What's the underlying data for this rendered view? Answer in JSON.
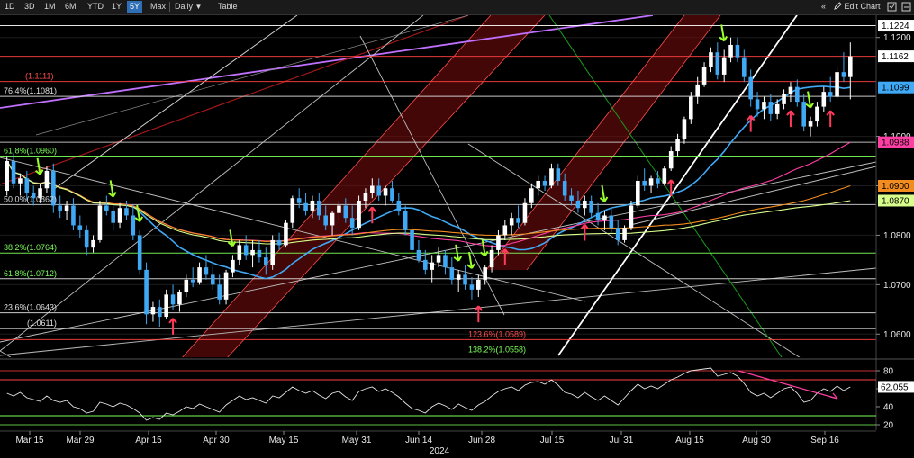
{
  "toolbar": {
    "ranges": [
      "1D",
      "3D",
      "1M",
      "6M",
      "YTD",
      "1Y",
      "5Y",
      "Max"
    ],
    "active": "5Y",
    "frequency": "Daily",
    "frequency_arrow": "▼",
    "table": "Table",
    "collapse_icon": "«",
    "edit_chart": "Edit Chart",
    "edit_icon": "pencil-icon",
    "expand_icon": "expand-icon"
  },
  "price_badges": [
    {
      "value": "1.1224",
      "bg": "#ffffff",
      "fg": "#000000"
    },
    {
      "value": "1.1162",
      "bg": "#ffffff",
      "fg": "#000000"
    },
    {
      "value": "1.1099",
      "bg": "#3fa9f5",
      "fg": "#000000"
    },
    {
      "value": "1.0988",
      "bg": "#ff3fa4",
      "fg": "#000000"
    },
    {
      "value": "1.0900",
      "bg": "#f28c1f",
      "fg": "#000000"
    },
    {
      "value": "1.0870",
      "bg": "#d8ff8c",
      "fg": "#000000"
    }
  ],
  "rsi_badge": {
    "value": "62.055",
    "bg": "#ffffff",
    "fg": "#000000"
  },
  "fib_labels": [
    {
      "text": "76.4%(1.1081)",
      "color": "#e0e0e0"
    },
    {
      "text": "61.8%(1.0960)",
      "color": "#7cff5a"
    },
    {
      "text": "50.0%(1.0862)",
      "color": "#d8d8d8"
    },
    {
      "text": "38.2%(1.0764)",
      "color": "#7cff5a"
    },
    {
      "text": "61.8%(1.0712)",
      "color": "#7cff5a"
    },
    {
      "text": "23.6%(1.0643)",
      "color": "#e0e0e0"
    },
    {
      "text": "(1.0611)",
      "color": "#e0e0e0"
    },
    {
      "text": "(1.1111)",
      "color": "#ff5050"
    },
    {
      "text": "123.6%(1.0589)",
      "color": "#ff5050"
    },
    {
      "text": "138.2%(1.0558)",
      "color": "#7cff5a"
    }
  ],
  "chart_data": {
    "type": "candlestick",
    "instrument_note": "",
    "x_axis": {
      "ticks": [
        "Mar 15",
        "Mar 29",
        "Apr 15",
        "Apr 30",
        "May 15",
        "May 31",
        "Jun 14",
        "Jun 28",
        "Jul 15",
        "Jul 31",
        "Aug 15",
        "Aug 30",
        "Sep 16"
      ],
      "year_label": "2024"
    },
    "y_axis": {
      "ticks": [
        1.06,
        1.07,
        1.08,
        1.09,
        1.1,
        1.12
      ],
      "range": [
        1.0555,
        1.1245
      ]
    },
    "rsi_axis": {
      "ticks": [
        80,
        60,
        40,
        20
      ],
      "range": [
        15,
        87
      ],
      "last": 62.055
    },
    "horizontal_levels": [
      {
        "value": 1.1224,
        "color": "#ffffff"
      },
      {
        "value": 1.1162,
        "color": "#ff4040"
      },
      {
        "value": 1.1111,
        "color": "#ff4040"
      },
      {
        "value": 1.1081,
        "color": "#e0e0e0"
      },
      {
        "value": 1.0988,
        "color": "#cfcfcf"
      },
      {
        "value": 1.096,
        "color": "#7cff5a"
      },
      {
        "value": 1.0862,
        "color": "#d0d0d0"
      },
      {
        "value": 1.0764,
        "color": "#7cff5a"
      },
      {
        "value": 1.0712,
        "color": "#e0e0e0"
      },
      {
        "value": 1.0643,
        "color": "#e0e0e0"
      },
      {
        "value": 1.0611,
        "color": "#cfcfcf"
      },
      {
        "value": 1.0589,
        "color": "#ff4040"
      }
    ],
    "candles": [
      [
        1.089,
        1.096,
        1.088,
        1.095
      ],
      [
        1.095,
        1.0965,
        1.0895,
        1.0905
      ],
      [
        1.0905,
        1.0925,
        1.088,
        1.0915
      ],
      [
        1.0915,
        1.093,
        1.087,
        1.0885
      ],
      [
        1.0885,
        1.09,
        1.086,
        1.0875
      ],
      [
        1.0875,
        1.0905,
        1.0865,
        1.0895
      ],
      [
        1.0895,
        1.094,
        1.0885,
        1.093
      ],
      [
        1.093,
        1.0945,
        1.0845,
        1.086
      ],
      [
        1.086,
        1.088,
        1.0835,
        1.085
      ],
      [
        1.085,
        1.087,
        1.083,
        1.086
      ],
      [
        1.086,
        1.0875,
        1.081,
        1.082
      ],
      [
        1.082,
        1.084,
        1.0795,
        1.081
      ],
      [
        1.081,
        1.082,
        1.076,
        1.0775
      ],
      [
        1.0775,
        1.08,
        1.0765,
        1.079
      ],
      [
        1.079,
        1.087,
        1.0785,
        1.086
      ],
      [
        1.086,
        1.088,
        1.084,
        1.085
      ],
      [
        1.085,
        1.086,
        1.081,
        1.0825
      ],
      [
        1.0825,
        1.0865,
        1.0815,
        1.0855
      ],
      [
        1.0855,
        1.087,
        1.083,
        1.084
      ],
      [
        1.084,
        1.086,
        1.079,
        1.08
      ],
      [
        1.08,
        1.081,
        1.072,
        1.073
      ],
      [
        1.073,
        1.0745,
        1.062,
        1.064
      ],
      [
        1.064,
        1.0665,
        1.0625,
        1.0655
      ],
      [
        1.0655,
        1.067,
        1.0615,
        1.0635
      ],
      [
        1.0635,
        1.069,
        1.063,
        1.068
      ],
      [
        1.068,
        1.07,
        1.065,
        1.066
      ],
      [
        1.066,
        1.069,
        1.0645,
        1.0685
      ],
      [
        1.0685,
        1.072,
        1.0675,
        1.071
      ],
      [
        1.071,
        1.0735,
        1.0695,
        1.0705
      ],
      [
        1.0705,
        1.0745,
        1.07,
        1.0735
      ],
      [
        1.0735,
        1.076,
        1.071,
        1.072
      ],
      [
        1.072,
        1.074,
        1.069,
        1.07
      ],
      [
        1.07,
        1.072,
        1.066,
        1.067
      ],
      [
        1.067,
        1.073,
        1.066,
        1.0725
      ],
      [
        1.0725,
        1.076,
        1.0715,
        1.075
      ],
      [
        1.075,
        1.079,
        1.074,
        1.078
      ],
      [
        1.078,
        1.08,
        1.075,
        1.076
      ],
      [
        1.076,
        1.079,
        1.0735,
        1.077
      ],
      [
        1.077,
        1.079,
        1.0745,
        1.0755
      ],
      [
        1.0755,
        1.0775,
        1.072,
        1.074
      ],
      [
        1.074,
        1.08,
        1.073,
        1.079
      ],
      [
        1.079,
        1.0805,
        1.077,
        1.078
      ],
      [
        1.078,
        1.083,
        1.0775,
        1.0825
      ],
      [
        1.0825,
        1.088,
        1.0815,
        1.0875
      ],
      [
        1.0875,
        1.0895,
        1.0855,
        1.0865
      ],
      [
        1.0865,
        1.0885,
        1.084,
        1.085
      ],
      [
        1.085,
        1.088,
        1.0835,
        1.087
      ],
      [
        1.087,
        1.0885,
        1.083,
        1.084
      ],
      [
        1.084,
        1.086,
        1.081,
        1.082
      ],
      [
        1.082,
        1.085,
        1.08,
        1.0845
      ],
      [
        1.0845,
        1.087,
        1.083,
        1.086
      ],
      [
        1.086,
        1.0875,
        1.0825,
        1.0835
      ],
      [
        1.0835,
        1.086,
        1.08,
        1.0815
      ],
      [
        1.0815,
        1.088,
        1.081,
        1.087
      ],
      [
        1.087,
        1.0895,
        1.0855,
        1.0885
      ],
      [
        1.0885,
        1.0915,
        1.0875,
        1.09
      ],
      [
        1.09,
        1.0915,
        1.087,
        1.088
      ],
      [
        1.088,
        1.09,
        1.086,
        1.0895
      ],
      [
        1.0895,
        1.091,
        1.0865,
        1.087
      ],
      [
        1.087,
        1.0885,
        1.084,
        1.085
      ],
      [
        1.085,
        1.086,
        1.08,
        1.081
      ],
      [
        1.081,
        1.082,
        1.076,
        1.077
      ],
      [
        1.077,
        1.079,
        1.0745,
        1.075
      ],
      [
        1.075,
        1.077,
        1.072,
        1.073
      ],
      [
        1.073,
        1.076,
        1.0705,
        1.0745
      ],
      [
        1.0745,
        1.0775,
        1.0735,
        1.076
      ],
      [
        1.076,
        1.077,
        1.072,
        1.0735
      ],
      [
        1.0735,
        1.0755,
        1.07,
        1.071
      ],
      [
        1.071,
        1.073,
        1.0685,
        1.072
      ],
      [
        1.072,
        1.074,
        1.069,
        1.07
      ],
      [
        1.07,
        1.0715,
        1.067,
        1.069
      ],
      [
        1.069,
        1.072,
        1.0675,
        1.071
      ],
      [
        1.071,
        1.074,
        1.07,
        1.0735
      ],
      [
        1.0735,
        1.078,
        1.0725,
        1.077
      ],
      [
        1.077,
        1.081,
        1.076,
        1.08
      ],
      [
        1.08,
        1.083,
        1.079,
        1.082
      ],
      [
        1.082,
        1.0845,
        1.08,
        1.0835
      ],
      [
        1.0835,
        1.086,
        1.0815,
        1.0825
      ],
      [
        1.0825,
        1.0875,
        1.082,
        1.0865
      ],
      [
        1.0865,
        1.0905,
        1.0855,
        1.0895
      ],
      [
        1.0895,
        1.092,
        1.088,
        1.091
      ],
      [
        1.091,
        1.092,
        1.089,
        1.09
      ],
      [
        1.09,
        1.0945,
        1.0895,
        1.0935
      ],
      [
        1.0935,
        1.0945,
        1.09,
        1.091
      ],
      [
        1.091,
        1.0925,
        1.087,
        1.088
      ],
      [
        1.088,
        1.0895,
        1.086,
        1.087
      ],
      [
        1.087,
        1.089,
        1.0845,
        1.0855
      ],
      [
        1.0855,
        1.088,
        1.084,
        1.087
      ],
      [
        1.087,
        1.088,
        1.0835,
        1.0845
      ],
      [
        1.0845,
        1.0865,
        1.082,
        1.083
      ],
      [
        1.083,
        1.085,
        1.081,
        1.084
      ],
      [
        1.084,
        1.0855,
        1.0805,
        1.0815
      ],
      [
        1.0815,
        1.083,
        1.078,
        1.079
      ],
      [
        1.079,
        1.082,
        1.0785,
        1.0815
      ],
      [
        1.0815,
        1.087,
        1.081,
        1.086
      ],
      [
        1.086,
        1.092,
        1.0855,
        1.091
      ],
      [
        1.091,
        1.0935,
        1.089,
        1.09
      ],
      [
        1.09,
        1.092,
        1.0885,
        1.0915
      ],
      [
        1.0915,
        1.093,
        1.0895,
        1.0905
      ],
      [
        1.0905,
        1.094,
        1.09,
        1.0935
      ],
      [
        1.0935,
        1.098,
        1.093,
        1.097
      ],
      [
        1.097,
        1.1005,
        1.096,
        1.0995
      ],
      [
        1.0995,
        1.104,
        1.0985,
        1.1035
      ],
      [
        1.1035,
        1.109,
        1.1025,
        1.108
      ],
      [
        1.108,
        1.112,
        1.1065,
        1.1105
      ],
      [
        1.1105,
        1.115,
        1.11,
        1.114
      ],
      [
        1.114,
        1.118,
        1.113,
        1.117
      ],
      [
        1.117,
        1.119,
        1.1115,
        1.1125
      ],
      [
        1.1125,
        1.1175,
        1.111,
        1.116
      ],
      [
        1.116,
        1.12,
        1.115,
        1.1185
      ],
      [
        1.1185,
        1.12,
        1.115,
        1.116
      ],
      [
        1.116,
        1.1175,
        1.111,
        1.112
      ],
      [
        1.112,
        1.1135,
        1.106,
        1.1075
      ],
      [
        1.1075,
        1.109,
        1.104,
        1.1055
      ],
      [
        1.1055,
        1.108,
        1.1035,
        1.107
      ],
      [
        1.107,
        1.1085,
        1.103,
        1.1045
      ],
      [
        1.1045,
        1.1075,
        1.1035,
        1.1065
      ],
      [
        1.1065,
        1.1095,
        1.1055,
        1.1085
      ],
      [
        1.1085,
        1.111,
        1.107,
        1.11
      ],
      [
        1.11,
        1.1115,
        1.106,
        1.107
      ],
      [
        1.107,
        1.1085,
        1.101,
        1.102
      ],
      [
        1.102,
        1.104,
        1.1,
        1.103
      ],
      [
        1.103,
        1.107,
        1.102,
        1.106
      ],
      [
        1.106,
        1.11,
        1.105,
        1.109
      ],
      [
        1.109,
        1.112,
        1.107,
        1.108
      ],
      [
        1.108,
        1.114,
        1.1075,
        1.113
      ],
      [
        1.113,
        1.117,
        1.111,
        1.112
      ],
      [
        1.112,
        1.119,
        1.1075,
        1.1162
      ]
    ],
    "moving_averages": [
      {
        "color": "#3fa9f5",
        "last": 1.1099
      },
      {
        "color": "#ff3fa4",
        "last": 1.0988
      },
      {
        "color": "#f28c1f",
        "last": 1.09
      },
      {
        "color": "#d8ff8c",
        "last": 1.087
      }
    ],
    "rsi": [
      55,
      52,
      56,
      50,
      48,
      46,
      52,
      47,
      45,
      47,
      40,
      38,
      33,
      35,
      45,
      43,
      40,
      44,
      42,
      38,
      33,
      25,
      28,
      26,
      33,
      31,
      35,
      40,
      38,
      43,
      40,
      37,
      34,
      42,
      47,
      52,
      48,
      50,
      47,
      44,
      52,
      50,
      56,
      62,
      58,
      55,
      58,
      53,
      49,
      55,
      57,
      51,
      47,
      57,
      60,
      62,
      57,
      60,
      56,
      51,
      44,
      38,
      36,
      33,
      40,
      44,
      41,
      37,
      43,
      39,
      36,
      42,
      46,
      52,
      57,
      60,
      62,
      58,
      64,
      67,
      68,
      65,
      70,
      64,
      56,
      54,
      50,
      56,
      51,
      47,
      52,
      47,
      42,
      50,
      58,
      65,
      60,
      63,
      60,
      65,
      70,
      73,
      77,
      80,
      81,
      82,
      83,
      74,
      76,
      78,
      74,
      66,
      56,
      52,
      55,
      50,
      55,
      60,
      62,
      55,
      45,
      47,
      55,
      60,
      57,
      63,
      58,
      62
    ]
  }
}
